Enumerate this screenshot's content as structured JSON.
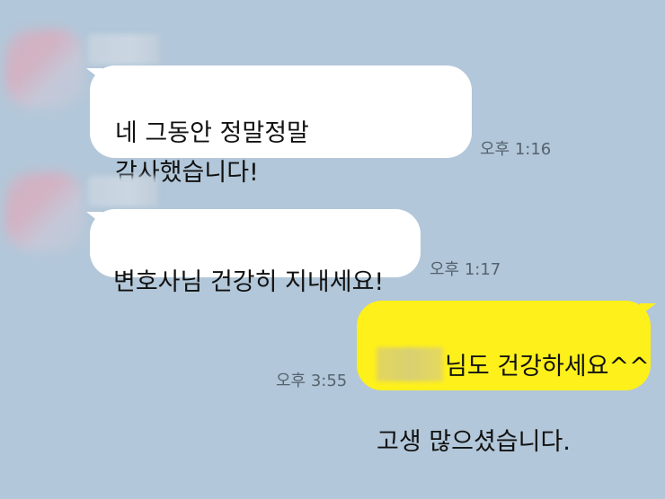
{
  "messages": [
    {
      "direction": "incoming",
      "text": "네 그동안 정말정말\n감사했습니다!",
      "time": "오후 1:16"
    },
    {
      "direction": "incoming",
      "text": "변호사님 건강히 지내세요!",
      "time": "오후 1:17"
    },
    {
      "direction": "outgoing",
      "text_line1": "님도 건강하세요^^",
      "text_line2": "고생 많으셨습니다.",
      "time": "오후 3:55"
    }
  ],
  "colors": {
    "background": "#b2c7d9",
    "incoming_bubble": "#ffffff",
    "outgoing_bubble": "#fef01b",
    "timestamp": "#55636f"
  }
}
